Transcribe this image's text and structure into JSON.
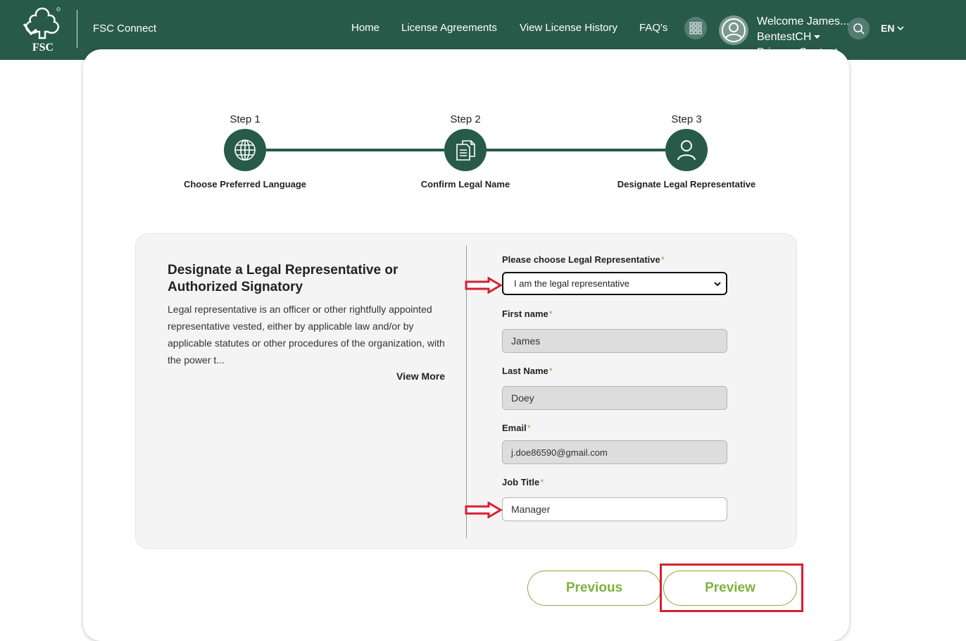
{
  "header": {
    "logo_text": "FSC",
    "app_title": "FSC Connect",
    "nav": {
      "home": "Home",
      "license_agreements": "License Agreements",
      "view_license_history": "View License History",
      "faqs": "FAQ's"
    },
    "user": {
      "welcome": "Welcome James...",
      "org": "BentestCH",
      "role": "Primary Contact"
    },
    "language": "EN"
  },
  "stepper": {
    "steps": [
      {
        "label": "Step 1",
        "title": "Choose Preferred Language",
        "icon": "globe-icon"
      },
      {
        "label": "Step 2",
        "title": "Confirm Legal Name",
        "icon": "document-icon"
      },
      {
        "label": "Step 3",
        "title": "Designate Legal Representative",
        "icon": "person-icon"
      }
    ]
  },
  "panel": {
    "heading": "Designate a Legal Representative or Authorized Signatory",
    "description": "Legal representative is an officer or other rightfully appointed representative vested, either by applicable law and/or by applicable statutes or other procedures of the organization, with the power t...",
    "view_more": "View More"
  },
  "form": {
    "legal_rep_label": "Please choose Legal Representative",
    "legal_rep_value": "I am the legal representative",
    "first_name_label": "First name",
    "first_name_value": "James",
    "last_name_label": "Last Name",
    "last_name_value": "Doey",
    "email_label": "Email",
    "email_value": "j.doe86590@gmail.com",
    "job_title_label": "Job Title",
    "job_title_value": "Manager",
    "required_marker": "*"
  },
  "actions": {
    "previous": "Previous",
    "preview": "Preview"
  },
  "colors": {
    "header_bg": "#285a4a",
    "accent_green": "#7fb13e",
    "annotation_red": "#d7202f"
  }
}
